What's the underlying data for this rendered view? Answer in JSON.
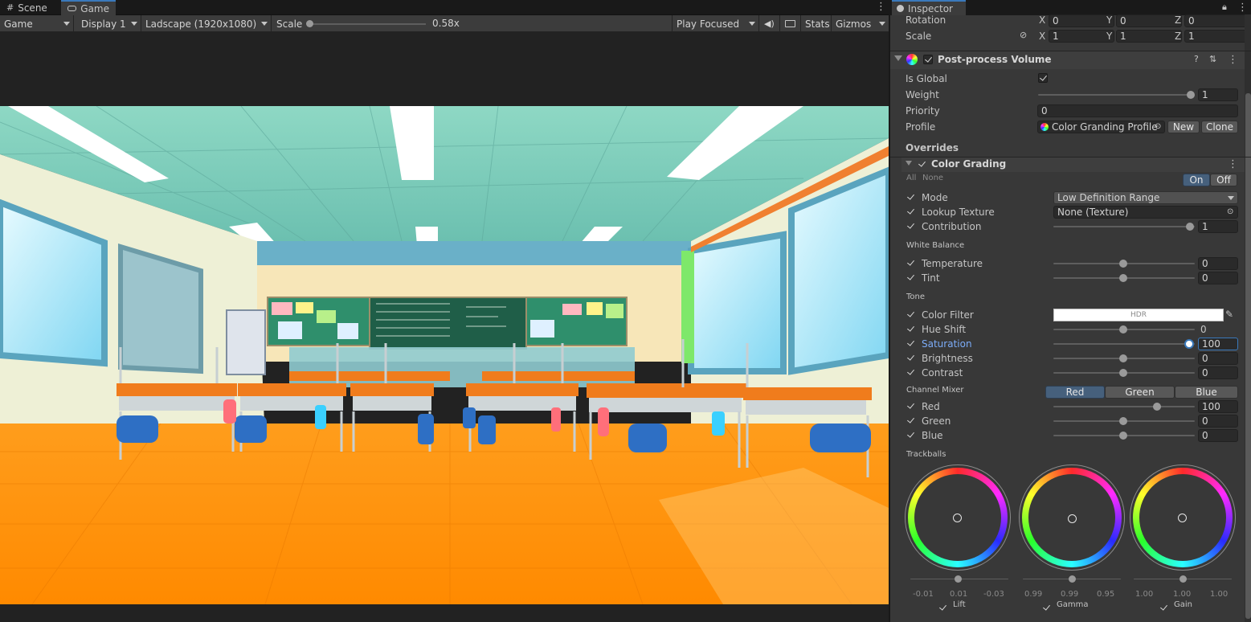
{
  "tabs_left": [
    {
      "label": "Scene",
      "icon": "grid-icon"
    },
    {
      "label": "Game",
      "icon": "gamepad-icon"
    }
  ],
  "toolbar": {
    "game_dropdown": "Game",
    "display_dropdown": "Display 1",
    "resolution_dropdown": "Ladscape (1920x1080)",
    "scale_label": "Scale",
    "scale_value": "0.58x",
    "scale_slider_level": 0.0,
    "play_mode_dropdown": "Play Focused",
    "stats_label": "Stats",
    "gizmos_label": "Gizmos"
  },
  "inspector": {
    "tab_label": "Inspector",
    "transform": {
      "rotation_label": "Rotation",
      "rotation": {
        "x": "0",
        "y": "0",
        "z": "0"
      },
      "scale_label": "Scale",
      "scale": {
        "x": "1",
        "y": "1",
        "z": "1"
      },
      "axis_labels": {
        "x": "X",
        "y": "Y",
        "z": "Z"
      }
    },
    "component_title": "Post-process Volume",
    "is_global_label": "Is Global",
    "weight_label": "Weight",
    "weight_value": "1",
    "priority_label": "Priority",
    "priority_value": "0",
    "profile_label": "Profile",
    "profile_value": "Color Granding Profile",
    "new_button": "New",
    "clone_button": "Clone",
    "overrides_label": "Overrides",
    "effect_title": "Color Grading",
    "all_label": "All",
    "none_label": "None",
    "on_label": "On",
    "off_label": "Off",
    "mode_label": "Mode",
    "mode_value": "Low Definition Range",
    "lookup_label": "Lookup Texture",
    "lookup_value": "None (Texture)",
    "contribution_label": "Contribution",
    "contribution_value": "1",
    "white_balance_label": "White Balance",
    "temperature_label": "Temperature",
    "temperature_value": "0",
    "tint_label": "Tint",
    "tint_value": "0",
    "tone_label": "Tone",
    "color_filter_label": "Color Filter",
    "color_filter_hdr": "HDR",
    "hue_shift_label": "Hue Shift",
    "hue_shift_value": "0",
    "saturation_label": "Saturation",
    "saturation_value": "100",
    "brightness_label": "Brightness",
    "brightness_value": "0",
    "contrast_label": "Contrast",
    "contrast_value": "0",
    "channel_mixer_label": "Channel Mixer",
    "mixer_tabs": [
      "Red",
      "Green",
      "Blue"
    ],
    "red_label": "Red",
    "red_value": "100",
    "green_label": "Green",
    "green_value": "0",
    "blue_label": "Blue",
    "blue_value": "0",
    "trackballs_label": "Trackballs",
    "trackballs": [
      {
        "name": "Lift",
        "values": [
          "-0.01",
          "0.01",
          "-0.03"
        ]
      },
      {
        "name": "Gamma",
        "values": [
          "0.99",
          "0.99",
          "0.95"
        ]
      },
      {
        "name": "Gain",
        "values": [
          "1.00",
          "1.00",
          "1.00"
        ]
      }
    ]
  },
  "colors": {
    "accent": "#3a79bb",
    "panel": "#383838",
    "field": "#2a2a2a",
    "highlight_text": "#7cacf8",
    "on_button": "#46607c"
  }
}
